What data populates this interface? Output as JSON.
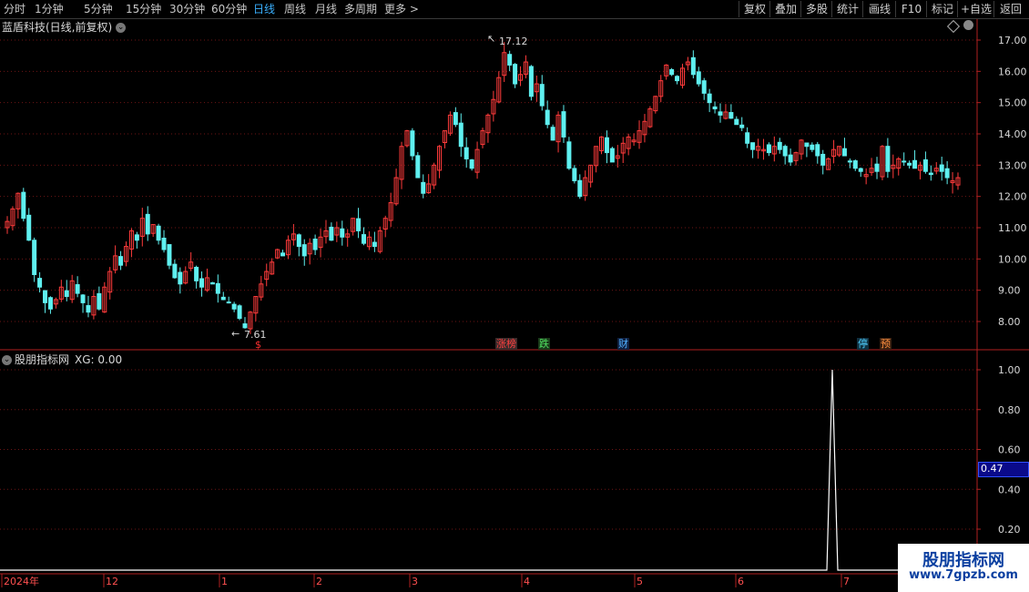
{
  "toolbar": {
    "periods": [
      "分时",
      "1分钟",
      "5分钟",
      "15分钟",
      "30分钟",
      "60分钟",
      "日线",
      "周线",
      "月线",
      "多周期",
      "更多"
    ],
    "active_period": "日线",
    "more_arrow": ">",
    "right_buttons": [
      "复权",
      "叠加",
      "多股",
      "统计",
      "画线",
      "F10",
      "标记",
      "+自选",
      "返回"
    ]
  },
  "stock": {
    "title": "蓝盾科技(日线,前复权)",
    "dropdown_icon": "chevron-down-icon",
    "high_label": "17.12",
    "low_label": "7.61"
  },
  "signals": [
    {
      "text": "$",
      "color": "#ff3030",
      "bg": "#000000"
    },
    {
      "text": "涨榜",
      "color": "#ff3030",
      "bg": "#3a2a2a"
    },
    {
      "text": "跌",
      "color": "#50e060",
      "bg": "#1a3a1a"
    },
    {
      "text": "财",
      "color": "#50b0ff",
      "bg": "#102040"
    },
    {
      "text": "停",
      "color": "#50d0ff",
      "bg": "#103040"
    },
    {
      "text": "预",
      "color": "#ff9040",
      "bg": "#3a2010"
    }
  ],
  "indicator": {
    "title": "股朋指标网",
    "xg_label": "XG: 0.00",
    "current_value": "0.47"
  },
  "colors": {
    "up": "#ff3b3b",
    "down": "#5ff0f0",
    "grid": "#6e1515",
    "axis": "#b02020"
  },
  "chart_data": {
    "type": "candlestick",
    "price_axis": {
      "ticks": [
        8.0,
        9.0,
        10.0,
        11.0,
        12.0,
        13.0,
        14.0,
        15.0,
        16.0,
        17.0
      ],
      "range": [
        7.0,
        17.9
      ]
    },
    "indicator_axis": {
      "ticks": [
        0.2,
        0.4,
        0.6,
        0.8,
        1.0
      ],
      "range": [
        0,
        1.1
      ]
    },
    "time_axis": [
      "2024年",
      "12",
      "1",
      "2",
      "3",
      "4",
      "5",
      "6",
      "7"
    ],
    "close_series": [
      11.2,
      11.6,
      12.1,
      11.3,
      10.6,
      9.5,
      9.1,
      8.6,
      8.4,
      8.7,
      9.1,
      8.8,
      9.3,
      8.9,
      8.6,
      8.3,
      8.8,
      8.4,
      9.1,
      9.6,
      10.1,
      9.8,
      10.4,
      10.9,
      10.6,
      11.3,
      10.8,
      11.1,
      10.6,
      10.3,
      9.8,
      9.4,
      9.2,
      9.6,
      9.9,
      9.3,
      9.1,
      9.4,
      9.2,
      8.9,
      8.7,
      8.6,
      8.4,
      8.1,
      7.8,
      8.3,
      8.8,
      9.2,
      9.6,
      9.9,
      10.3,
      10.1,
      10.6,
      10.8,
      10.4,
      10.1,
      10.5,
      10.3,
      10.7,
      10.9,
      10.6,
      11.0,
      10.7,
      10.8,
      11.3,
      10.9,
      10.5,
      10.7,
      10.4,
      10.9,
      11.3,
      11.8,
      12.6,
      13.6,
      14.1,
      13.3,
      12.6,
      12.1,
      12.4,
      13.0,
      13.6,
      14.1,
      14.6,
      14.3,
      13.6,
      13.2,
      12.9,
      13.5,
      14.1,
      14.6,
      15.1,
      15.8,
      16.6,
      16.2,
      15.6,
      15.9,
      16.3,
      15.2,
      15.6,
      14.9,
      14.3,
      13.8,
      14.6,
      13.9,
      12.9,
      12.5,
      12.0,
      12.6,
      13.0,
      13.6,
      13.9,
      13.4,
      13.1,
      13.3,
      13.7,
      13.9,
      13.8,
      14.1,
      14.4,
      14.8,
      15.2,
      15.7,
      16.2,
      15.9,
      15.7,
      16.1,
      16.3,
      15.9,
      15.6,
      15.3,
      15.0,
      14.8,
      14.6,
      14.7,
      14.5,
      14.3,
      14.2,
      13.7,
      13.5,
      13.6,
      13.5,
      13.4,
      13.6,
      13.5,
      13.3,
      13.1,
      13.4,
      13.8,
      13.6,
      13.5,
      13.3,
      13.0,
      13.2,
      13.5,
      13.6,
      13.3,
      13.1,
      12.9,
      12.8,
      12.7,
      12.9,
      12.8,
      13.6,
      12.8,
      13.0,
      13.2,
      13.1,
      13.0,
      12.9,
      13.0,
      12.8,
      12.7,
      12.9,
      12.8,
      12.6,
      12.5,
      12.6
    ]
  }
}
